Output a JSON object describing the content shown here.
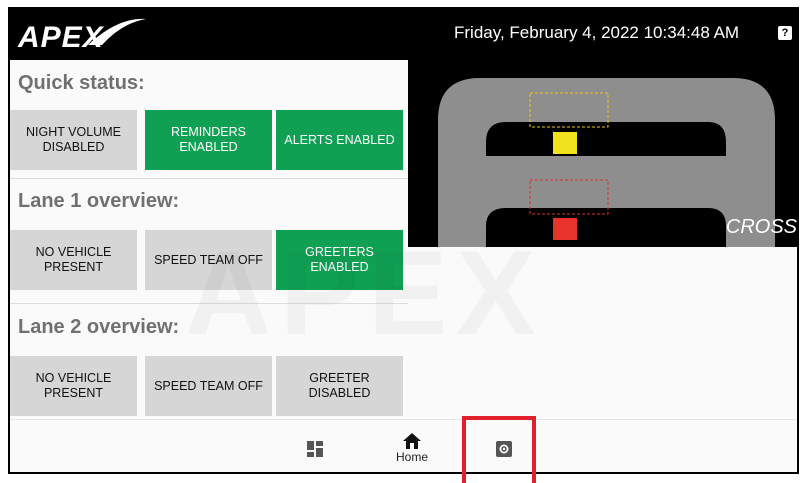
{
  "header": {
    "logo_text": "APEX",
    "datetime": "Friday, February 4, 2022 10:34:48 AM",
    "help_icon": "help-icon"
  },
  "quick_status": {
    "title": "Quick status:",
    "tiles": [
      {
        "label": "NIGHT VOLUME DISABLED",
        "state": "gray"
      },
      {
        "label": "REMINDERS ENABLED",
        "state": "green"
      },
      {
        "label": "ALERTS ENABLED",
        "state": "green"
      }
    ]
  },
  "lane1": {
    "title": "Lane 1 overview:",
    "tiles": [
      {
        "label": "NO VEHICLE PRESENT",
        "state": "gray"
      },
      {
        "label": "SPEED TEAM OFF",
        "state": "gray"
      },
      {
        "label": "GREETERS ENABLED",
        "state": "green"
      }
    ]
  },
  "lane2": {
    "title": "Lane 2 overview:",
    "tiles": [
      {
        "label": "NO VEHICLE PRESENT",
        "state": "gray"
      },
      {
        "label": "SPEED TEAM OFF",
        "state": "gray"
      },
      {
        "label": "GREETER DISABLED",
        "state": "gray"
      }
    ]
  },
  "map": {
    "label": "CROSS",
    "lane1_marker_color": "#f2e21e",
    "lane2_marker_color": "#e8332b"
  },
  "nav": {
    "dashboard_icon": "dashboard-icon",
    "home_label": "Home",
    "home_icon": "home-icon",
    "settings_icon": "settings-icon"
  },
  "colors": {
    "green": "#10a054",
    "gray_tile": "#d6d6d6",
    "highlight": "#e0202a"
  }
}
